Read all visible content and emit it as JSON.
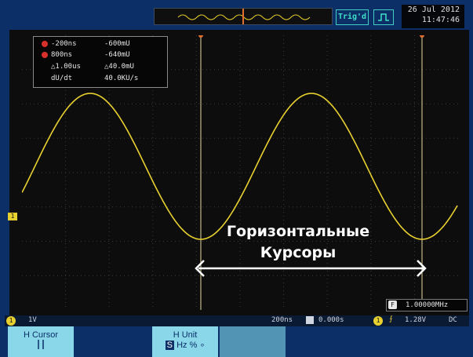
{
  "header": {
    "trig_status": "Trig'd",
    "date": "26 Jul 2012",
    "time": "11:47:46"
  },
  "cursor_readout": {
    "rows": [
      {
        "c1": "-200ns",
        "c2": "-600mU"
      },
      {
        "c1": "800ns",
        "c2": "-640mU"
      },
      {
        "c1": "△1.00us",
        "c2": "△40.0mU"
      },
      {
        "c1": "dU/dt",
        "c2": "40.0KU/s"
      }
    ],
    "marker_color": "#d8302a"
  },
  "frequency": {
    "badge": "F",
    "value": "1.00000MHz"
  },
  "status_bar": {
    "ch1_label": "1",
    "ch1_volts": "1V",
    "timebase": "200ns",
    "time_offset": "0.000s",
    "trigger_channel": "1",
    "trigger_level": "1.28V",
    "coupling": "DC"
  },
  "softkeys": {
    "h_cursor": "H Cursor",
    "h_unit": "H Unit",
    "unit_s": "S",
    "unit_hz": "Hz",
    "unit_pct": "%"
  },
  "caption": {
    "line1": "Горизонтальные",
    "line2": "Курсоры"
  },
  "channel_marker": "1",
  "colors": {
    "trace": "#e8d030",
    "cursor_line": "#e8d9a0",
    "accent": "#8ad7ea"
  }
}
